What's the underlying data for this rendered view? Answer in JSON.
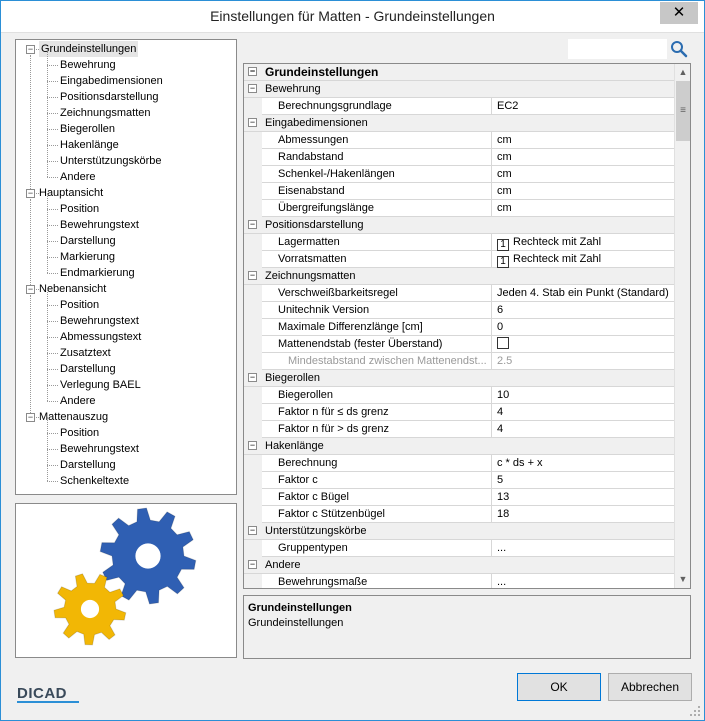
{
  "window": {
    "title": "Einstellungen für Matten - Grundeinstellungen",
    "close_label": "✕"
  },
  "search": {
    "value": "",
    "placeholder": ""
  },
  "tree": [
    {
      "label": "Grundeinstellungen",
      "level": 0,
      "selected": true
    },
    {
      "label": "Bewehrung",
      "level": 1
    },
    {
      "label": "Eingabedimensionen",
      "level": 1
    },
    {
      "label": "Positionsdarstellung",
      "level": 1
    },
    {
      "label": "Zeichnungsmatten",
      "level": 1
    },
    {
      "label": "Biegerollen",
      "level": 1
    },
    {
      "label": "Hakenlänge",
      "level": 1
    },
    {
      "label": "Unterstützungskörbe",
      "level": 1
    },
    {
      "label": "Andere",
      "level": 1
    },
    {
      "label": "Hauptansicht",
      "level": 0
    },
    {
      "label": "Position",
      "level": 1
    },
    {
      "label": "Bewehrungstext",
      "level": 1
    },
    {
      "label": "Darstellung",
      "level": 1
    },
    {
      "label": "Markierung",
      "level": 1
    },
    {
      "label": "Endmarkierung",
      "level": 1
    },
    {
      "label": "Nebenansicht",
      "level": 0
    },
    {
      "label": "Position",
      "level": 1
    },
    {
      "label": "Bewehrungstext",
      "level": 1
    },
    {
      "label": "Abmessungstext",
      "level": 1
    },
    {
      "label": "Zusatztext",
      "level": 1
    },
    {
      "label": "Darstellung",
      "level": 1
    },
    {
      "label": "Verlegung BAEL",
      "level": 1
    },
    {
      "label": "Andere",
      "level": 1
    },
    {
      "label": "Mattenauszug",
      "level": 0
    },
    {
      "label": "Position",
      "level": 1
    },
    {
      "label": "Bewehrungstext",
      "level": 1
    },
    {
      "label": "Darstellung",
      "level": 1
    },
    {
      "label": "Schenkeltexte",
      "level": 1
    }
  ],
  "grid": [
    {
      "type": "top",
      "label": "Grundeinstellungen"
    },
    {
      "type": "cat",
      "label": "Bewehrung"
    },
    {
      "type": "prop",
      "name": "Berechnungsgrundlage",
      "value": "EC2"
    },
    {
      "type": "cat",
      "label": "Eingabedimensionen"
    },
    {
      "type": "prop",
      "name": "Abmessungen",
      "value": "cm"
    },
    {
      "type": "prop",
      "name": "Randabstand",
      "value": "cm"
    },
    {
      "type": "prop",
      "name": "Schenkel-/Hakenlängen",
      "value": "cm"
    },
    {
      "type": "prop",
      "name": "Eisenabstand",
      "value": "cm"
    },
    {
      "type": "prop",
      "name": "Übergreifungslänge",
      "value": "cm"
    },
    {
      "type": "cat",
      "label": "Positionsdarstellung"
    },
    {
      "type": "prop",
      "name": "Lagermatten",
      "value": "Rechteck mit Zahl",
      "icon": "1"
    },
    {
      "type": "prop",
      "name": "Vorratsmatten",
      "value": "Rechteck mit Zahl",
      "icon": "1"
    },
    {
      "type": "cat",
      "label": "Zeichnungsmatten"
    },
    {
      "type": "prop",
      "name": "Verschweißbarkeitsregel",
      "value": "Jeden 4. Stab ein Punkt (Standard)"
    },
    {
      "type": "prop",
      "name": "Unitechnik Version",
      "value": "6"
    },
    {
      "type": "prop",
      "name": "Maximale Differenzlänge [cm]",
      "value": "0"
    },
    {
      "type": "prop",
      "name": "Mattenendstab (fester Überstand)",
      "value": "",
      "checkbox": true
    },
    {
      "type": "prop",
      "name": "Mindestabstand zwischen Mattenendst...",
      "value": "2.5",
      "disabled": true
    },
    {
      "type": "cat",
      "label": "Biegerollen"
    },
    {
      "type": "prop",
      "name": "Biegerollen",
      "value": "10"
    },
    {
      "type": "prop",
      "name": "Faktor n für ≤ ds grenz",
      "value": "4"
    },
    {
      "type": "prop",
      "name": "Faktor n für > ds grenz",
      "value": "4"
    },
    {
      "type": "cat",
      "label": "Hakenlänge"
    },
    {
      "type": "prop",
      "name": "Berechnung",
      "value": "c * ds + x"
    },
    {
      "type": "prop",
      "name": "Faktor c",
      "value": "5"
    },
    {
      "type": "prop",
      "name": "Faktor c Bügel",
      "value": "13"
    },
    {
      "type": "prop",
      "name": "Faktor c Stützenbügel",
      "value": "18"
    },
    {
      "type": "cat",
      "label": "Unterstützungskörbe"
    },
    {
      "type": "prop",
      "name": "Gruppentypen",
      "value": "..."
    },
    {
      "type": "cat",
      "label": "Andere"
    },
    {
      "type": "prop",
      "name": "Bewehrungsmaße",
      "value": "..."
    }
  ],
  "description": {
    "title": "Grundeinstellungen",
    "text": "Grundeinstellungen"
  },
  "buttons": {
    "ok": "OK",
    "cancel": "Abbrechen"
  },
  "logo": {
    "text": "DICAD"
  },
  "colors": {
    "gear_blue": "#2f5fb3",
    "gear_yellow": "#f2b705",
    "accent": "#0078d7"
  }
}
